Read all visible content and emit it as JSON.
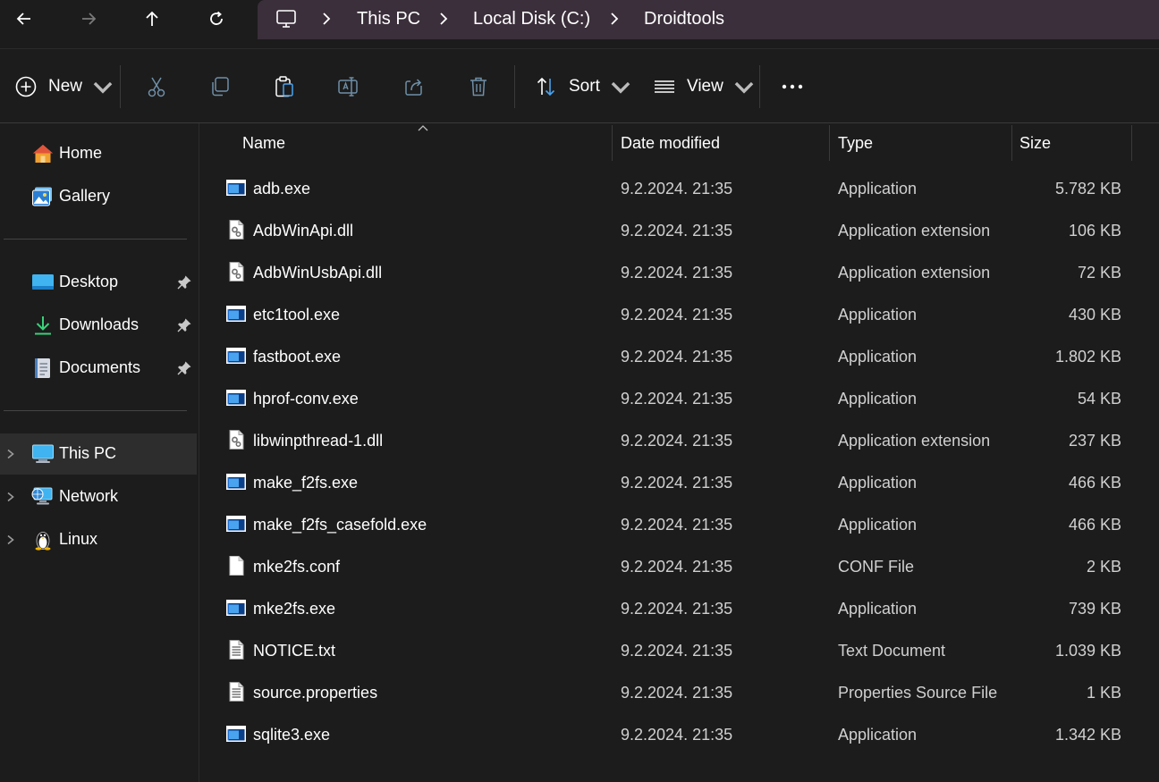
{
  "nav": {
    "back_icon": "arrow-left-icon",
    "forward_icon": "arrow-right-icon",
    "up_icon": "arrow-up-icon",
    "refresh_icon": "refresh-icon"
  },
  "breadcrumb": {
    "items": [
      "This PC",
      "Local Disk (C:)",
      "Droidtools"
    ]
  },
  "toolbar": {
    "new_label": "New",
    "sort_label": "Sort",
    "view_label": "View"
  },
  "sidebar": {
    "home": "Home",
    "gallery": "Gallery",
    "desktop": "Desktop",
    "downloads": "Downloads",
    "documents": "Documents",
    "this_pc": "This PC",
    "network": "Network",
    "linux": "Linux"
  },
  "columns": {
    "name": "Name",
    "date": "Date modified",
    "type": "Type",
    "size": "Size"
  },
  "files": [
    {
      "name": "adb.exe",
      "date": "9.2.2024. 21:35",
      "type": "Application",
      "size": "5.782 KB",
      "icon": "exe"
    },
    {
      "name": "AdbWinApi.dll",
      "date": "9.2.2024. 21:35",
      "type": "Application extension",
      "size": "106 KB",
      "icon": "dll"
    },
    {
      "name": "AdbWinUsbApi.dll",
      "date": "9.2.2024. 21:35",
      "type": "Application extension",
      "size": "72 KB",
      "icon": "dll"
    },
    {
      "name": "etc1tool.exe",
      "date": "9.2.2024. 21:35",
      "type": "Application",
      "size": "430 KB",
      "icon": "exe"
    },
    {
      "name": "fastboot.exe",
      "date": "9.2.2024. 21:35",
      "type": "Application",
      "size": "1.802 KB",
      "icon": "exe"
    },
    {
      "name": "hprof-conv.exe",
      "date": "9.2.2024. 21:35",
      "type": "Application",
      "size": "54 KB",
      "icon": "exe"
    },
    {
      "name": "libwinpthread-1.dll",
      "date": "9.2.2024. 21:35",
      "type": "Application extension",
      "size": "237 KB",
      "icon": "dll"
    },
    {
      "name": "make_f2fs.exe",
      "date": "9.2.2024. 21:35",
      "type": "Application",
      "size": "466 KB",
      "icon": "exe"
    },
    {
      "name": "make_f2fs_casefold.exe",
      "date": "9.2.2024. 21:35",
      "type": "Application",
      "size": "466 KB",
      "icon": "exe"
    },
    {
      "name": "mke2fs.conf",
      "date": "9.2.2024. 21:35",
      "type": "CONF File",
      "size": "2 KB",
      "icon": "blank"
    },
    {
      "name": "mke2fs.exe",
      "date": "9.2.2024. 21:35",
      "type": "Application",
      "size": "739 KB",
      "icon": "exe"
    },
    {
      "name": "NOTICE.txt",
      "date": "9.2.2024. 21:35",
      "type": "Text Document",
      "size": "1.039 KB",
      "icon": "text"
    },
    {
      "name": "source.properties",
      "date": "9.2.2024. 21:35",
      "type": "Properties Source File",
      "size": "1 KB",
      "icon": "text"
    },
    {
      "name": "sqlite3.exe",
      "date": "9.2.2024. 21:35",
      "type": "Application",
      "size": "1.342 KB",
      "icon": "exe"
    }
  ],
  "colors": {
    "background": "#1c1c1c",
    "address_bar": "#3b2f3b",
    "selected_nav": "#2d2d2d",
    "accent_blue": "#1e8ad6"
  }
}
